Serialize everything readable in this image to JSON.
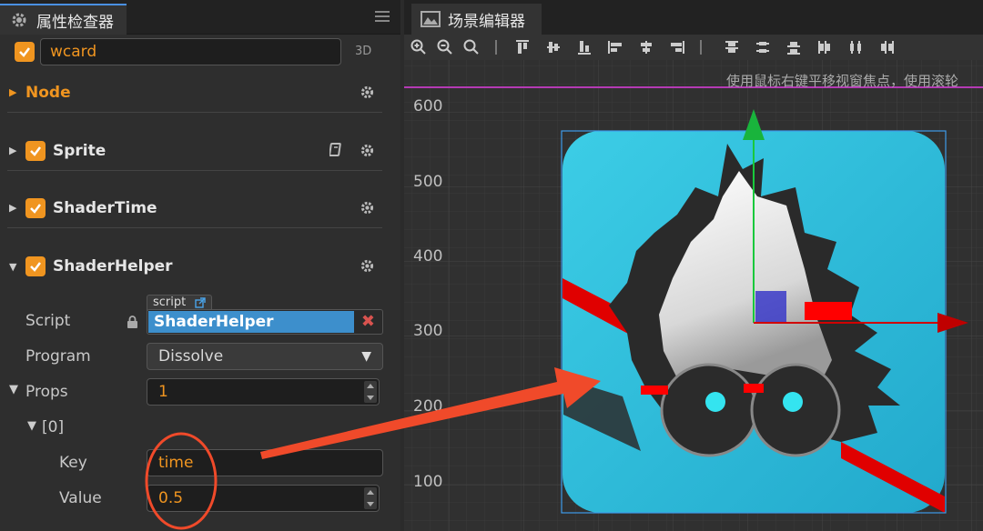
{
  "inspector": {
    "tab_title": "属性检查器",
    "node_name": "wcard",
    "mode_3d": "3D",
    "sections": {
      "node": "Node",
      "sprite": "Sprite",
      "shader_time": "ShaderTime",
      "shader_helper": "ShaderHelper"
    },
    "props": {
      "script_label": "Script",
      "script_tag": "script",
      "script_value": "ShaderHelper",
      "program_label": "Program",
      "program_value": "Dissolve",
      "props_label": "Props",
      "props_count": "1",
      "index_label": "[0]",
      "key_label": "Key",
      "key_value": "time",
      "value_label": "Value",
      "value_value": "0.5"
    }
  },
  "scene": {
    "tab_title": "场景编辑器",
    "hint": "使用鼠标右键平移视窗焦点，使用滚轮",
    "ruler": [
      "600",
      "500",
      "400",
      "300",
      "200",
      "100"
    ]
  },
  "colors": {
    "accent_orange": "#f09520",
    "selection_blue": "#3d8fcc",
    "annotation_red": "#f04a2a",
    "gizmo_green": "#19b43c",
    "gizmo_red": "#d10000",
    "card_cyan": "#33c6e0"
  }
}
